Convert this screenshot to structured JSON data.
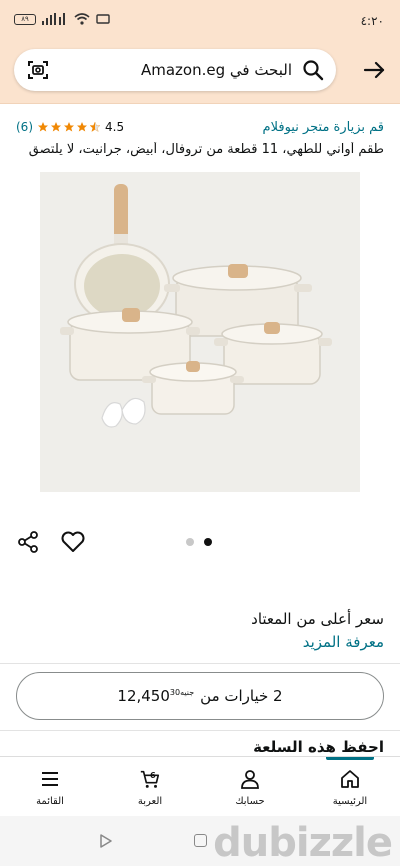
{
  "status_bar": {
    "time": "٤:٢٠",
    "battery": "٨٩"
  },
  "header": {
    "search_text": "البحث في Amazon.eg"
  },
  "product": {
    "store_link": "قم بزيارة متجر نيوفلام",
    "rating": "4.5",
    "review_count": "(6)",
    "stars": 4.5,
    "title": "طقم أواني للطهي، 11 قطعة من تروفال، أبيض، جرانيت، لا يلتصق"
  },
  "carousel": {
    "total": 2,
    "active_index": 1
  },
  "price_note": {
    "higher_than_usual": "سعر أعلى من المعتاد",
    "learn_more": "معرفة المزيد"
  },
  "options_button": {
    "prefix": "2 خيارات من",
    "amount": "12,450",
    "fraction": "30",
    "currency": "جنيه"
  },
  "save_section": {
    "title_part1": "احفظ",
    "title_part2": "هذه السلعة"
  },
  "bottom_nav": {
    "items": [
      {
        "label": "الرئيسية",
        "icon": "home-icon",
        "active": true
      },
      {
        "label": "حسابك",
        "icon": "account-icon",
        "active": false
      },
      {
        "label": "العربة",
        "icon": "cart-icon",
        "active": false,
        "badge": "6"
      },
      {
        "label": "القائمة",
        "icon": "menu-icon",
        "active": false
      }
    ]
  },
  "watermark": "dubizzle",
  "colors": {
    "header_bg": "#fbe3ce",
    "link": "#007185",
    "star": "#f08804"
  }
}
